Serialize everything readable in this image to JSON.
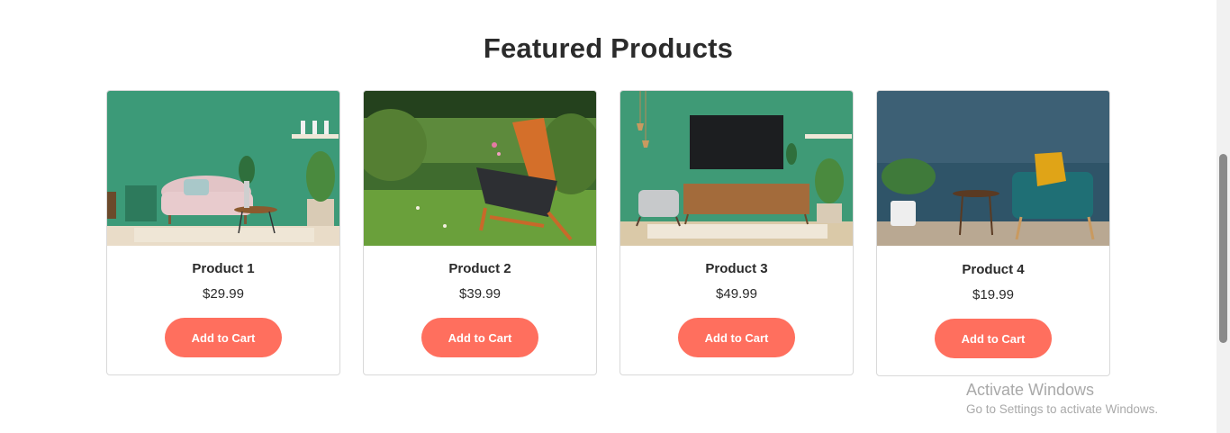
{
  "section": {
    "title": "Featured Products"
  },
  "products": [
    {
      "name": "Product 1",
      "price": "$29.99",
      "button": "Add to Cart",
      "image": "pink-sofa-green-wall"
    },
    {
      "name": "Product 2",
      "price": "$39.99",
      "button": "Add to Cart",
      "image": "wooden-chair-garden"
    },
    {
      "name": "Product 3",
      "price": "$49.99",
      "button": "Add to Cart",
      "image": "tv-console-green-wall"
    },
    {
      "name": "Product 4",
      "price": "$19.99",
      "button": "Add to Cart",
      "image": "teal-armchair-blue-wall"
    }
  ],
  "watermark": {
    "title": "Activate Windows",
    "subtitle": "Go to Settings to activate Windows."
  },
  "colors": {
    "button": "#ff6f5e",
    "card_border": "#d9d9d9",
    "title": "#2b2b2b"
  }
}
